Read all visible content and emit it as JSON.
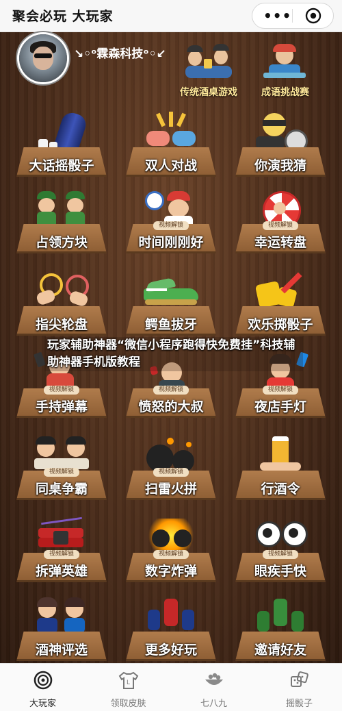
{
  "top_bar": {
    "title": "聚会必玩 大玩家",
    "more_icon": "three-dots-icon",
    "close_icon": "record-target-icon"
  },
  "profile": {
    "name": "↘◦ᵒ霖森科技ᵒ◦↙"
  },
  "header_games": [
    {
      "label": "传统酒桌游戏",
      "icon": "drinking-table-icon"
    },
    {
      "label": "成语挑战赛",
      "icon": "idiom-challenge-icon"
    }
  ],
  "lock_tag": "视频解锁",
  "games": [
    {
      "label": "大话摇骰子",
      "icon": "dice-cup-icon",
      "locked": false
    },
    {
      "label": "双人对战",
      "icon": "fist-bump-icon",
      "locked": false
    },
    {
      "label": "你演我猜",
      "icon": "charades-icon",
      "locked": false
    },
    {
      "label": "占领方块",
      "icon": "soldiers-icon",
      "locked": false
    },
    {
      "label": "时间刚刚好",
      "icon": "alarm-clock-icon",
      "locked": true
    },
    {
      "label": "幸运转盘",
      "icon": "lucky-wheel-icon",
      "locked": true
    },
    {
      "label": "指尖轮盘",
      "icon": "finger-touch-icon",
      "locked": false
    },
    {
      "label": "鳄鱼拔牙",
      "icon": "crocodile-icon",
      "locked": false
    },
    {
      "label": "欢乐掷骰子",
      "icon": "dice-icon",
      "locked": false
    },
    {
      "label": "手持弹幕",
      "icon": "phone-barrage-icon",
      "locked": true
    },
    {
      "label": "愤怒的大叔",
      "icon": "angry-uncle-icon",
      "locked": true
    },
    {
      "label": "夜店手灯",
      "icon": "club-light-icon",
      "locked": true
    },
    {
      "label": "同桌争霸",
      "icon": "deskmates-icon",
      "locked": true
    },
    {
      "label": "扫雷火拼",
      "icon": "bomb-icon",
      "locked": true
    },
    {
      "label": "行酒令",
      "icon": "beer-icon",
      "locked": false
    },
    {
      "label": "拆弹英雄",
      "icon": "dynamite-icon",
      "locked": true
    },
    {
      "label": "数字炸弹",
      "icon": "number-bomb-icon",
      "locked": true
    },
    {
      "label": "眼疾手快",
      "icon": "eyes-icon",
      "locked": true
    },
    {
      "label": "酒神评选",
      "icon": "couple-icon",
      "locked": false
    },
    {
      "label": "更多好玩",
      "icon": "more-games-icon",
      "locked": false
    },
    {
      "label": "邀请好友",
      "icon": "invite-friends-icon",
      "locked": false
    }
  ],
  "banner": {
    "text": "玩家辅助神器“微信小程序跑得快免费挂”科技辅助神器手机版教程"
  },
  "tabs": [
    {
      "label": "大玩家",
      "icon": "home-ring-icon",
      "active": true
    },
    {
      "label": "领取皮肤",
      "icon": "tshirt-icon",
      "active": false
    },
    {
      "label": "七八九",
      "icon": "bowl-icon",
      "active": false
    },
    {
      "label": "摇骰子",
      "icon": "dice-icon",
      "active": false
    }
  ],
  "colors": {
    "topbar_bg": "#f7f7f7",
    "board_wood": "#4b2d1b",
    "table_wood": "#a06f42",
    "header_label": "#ffe89a",
    "tab_active": "#222222",
    "tab_inactive": "#777777"
  }
}
